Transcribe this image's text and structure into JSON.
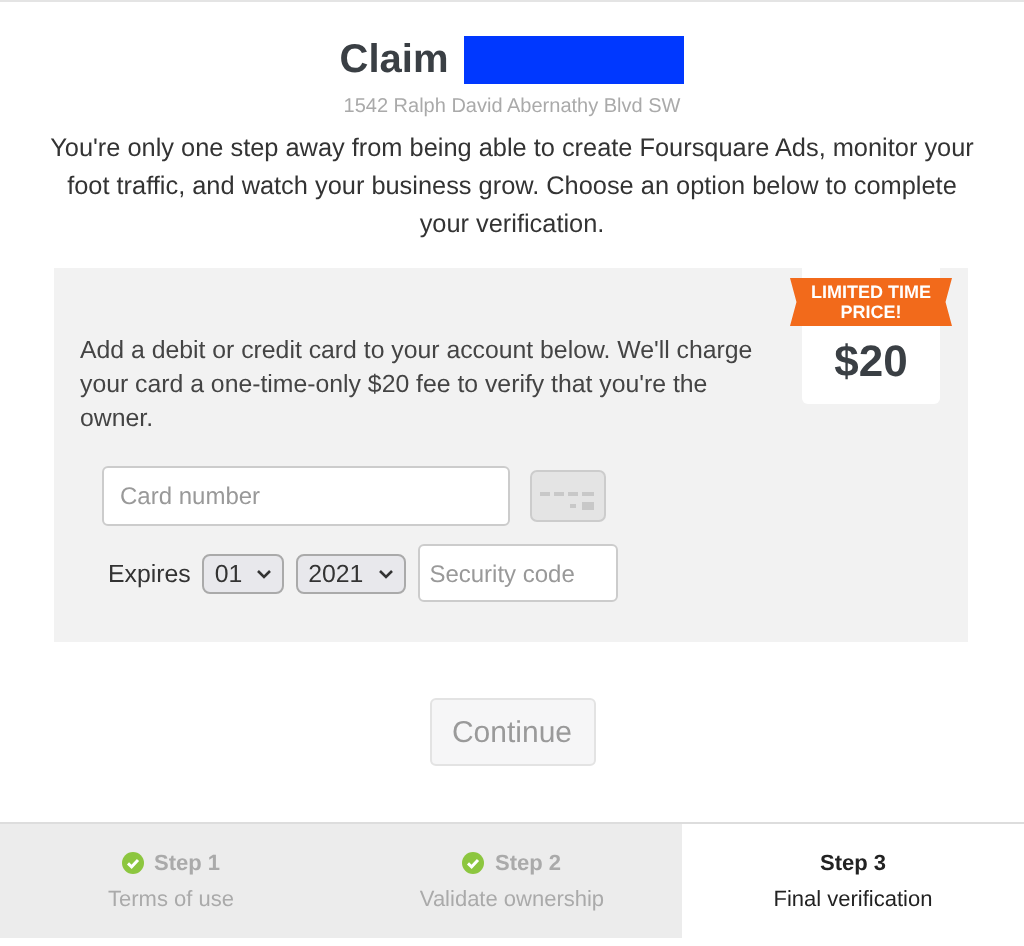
{
  "header": {
    "title": "Claim",
    "address": "1542 Ralph David Abernathy Blvd SW",
    "intro": "You're only one step away from being able to create Foursquare Ads, monitor your foot traffic, and watch your business grow. Choose an option below to complete your verification."
  },
  "payment": {
    "description": "Add a debit or credit card to your account below. We'll charge your card a one-time-only $20 fee to verify that you're the owner.",
    "card_number": {
      "placeholder": "Card number"
    },
    "expires_label": "Expires",
    "month": "01",
    "year": "2021",
    "security_code": {
      "placeholder": "Security code"
    },
    "price": {
      "ribbon": "LIMITED TIME PRICE!",
      "amount": "$20"
    }
  },
  "continue_button": {
    "label": "Continue",
    "disabled": true
  },
  "steps": [
    {
      "title": "Step 1",
      "subtitle": "Terms of use",
      "completed": true,
      "selected": false
    },
    {
      "title": "Step 2",
      "subtitle": "Validate ownership",
      "completed": true,
      "selected": false
    },
    {
      "title": "Step 3",
      "subtitle": "Final verification",
      "completed": false,
      "selected": true
    }
  ]
}
